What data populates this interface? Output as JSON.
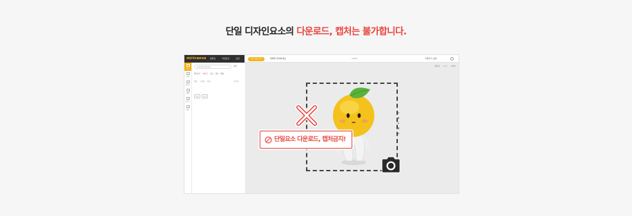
{
  "headline": {
    "prefix": "단일 디자인요소의 ",
    "highlight": "다운로드, 캡처는 불가합니다."
  },
  "app": {
    "logo": "miricanvas",
    "top_nav": [
      "템플릿",
      "작업공간",
      "요금"
    ],
    "pill_label": "모든 기능 무료",
    "doc_title": "제목을 입력하세요",
    "zoom": "100%",
    "save_label": "저장하기 공유"
  },
  "rail": {
    "items": [
      "요소",
      "사진",
      "텍스트",
      "배경",
      "업로드",
      "폴더"
    ]
  },
  "panel": {
    "search_placeholder": "검색어를 입력하세요",
    "search_button": "검색",
    "tabs": [
      "일러스트",
      "아이콘",
      "도형",
      "사진",
      "배경"
    ],
    "filters": [
      "색상",
      "스타일",
      "형태"
    ],
    "sort_label": "인기순",
    "chips": [
      "무료",
      "유료"
    ]
  },
  "canvas": {
    "toolbar": [
      "페이지",
      "1 / 1",
      "100%"
    ]
  },
  "banner_text": "단일요소 다운로드, 캡처금지!",
  "colors": {
    "accent": "#e8463e",
    "brand": "#f4b21a"
  },
  "icons": [
    "x-mark-icon",
    "no-entry-icon",
    "camera-icon"
  ]
}
